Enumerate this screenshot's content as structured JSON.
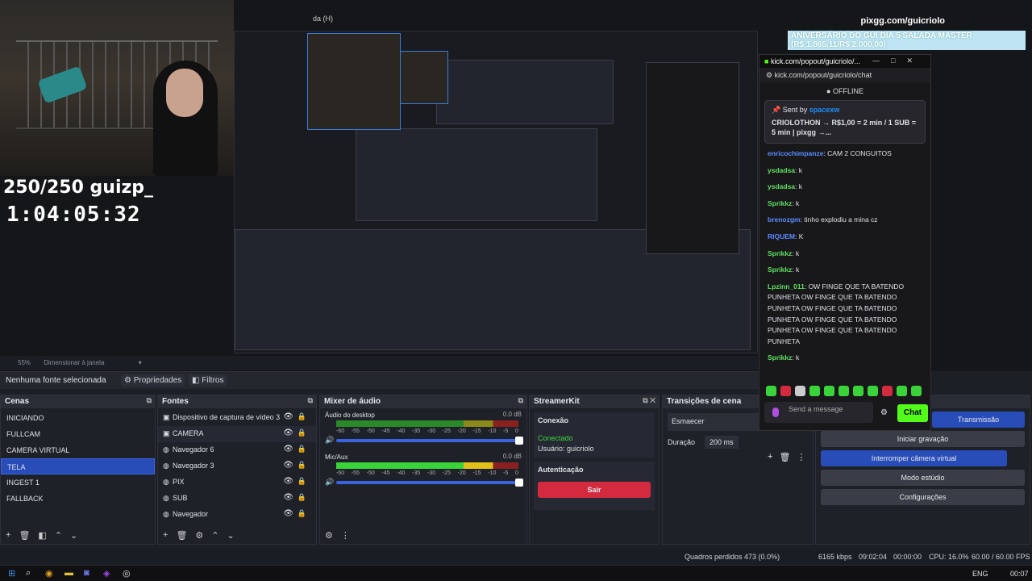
{
  "stream": {
    "channel_url": "pixgg.com/guicriolo",
    "banner_line1": "ANIVERSÁRIO DO GUI DIA 5 SALADA MASTER",
    "banner_line2": "(R$ 1.865,11/R$ 2.000,00)",
    "counter": "250/250 guizp_",
    "timer": "1:04:05:32"
  },
  "menu_fragment": "da (H)",
  "zoom": {
    "value": "55%",
    "label": "Dimensionar à janela"
  },
  "source_bar": {
    "status": "Nenhuma fonte selecionada",
    "properties": "Propriedades",
    "filters": "Filtros"
  },
  "scenes": {
    "title": "Cenas",
    "items": [
      "INICIANDO",
      "FULLCAM",
      "CAMERA VIRTUAL",
      "TELA",
      "INGEST 1",
      "FALLBACK"
    ],
    "selected": 3
  },
  "sources": {
    "title": "Fontes",
    "items": [
      "Dispositivo de captura de vídeo 3",
      "CAMERA",
      "Navegador 6",
      "Navegador 3",
      "PIX",
      "SUB",
      "Navegador"
    ]
  },
  "mixer": {
    "title": "Mixer de áudio",
    "channels": [
      {
        "name": "Áudio do desktop",
        "db": "0.0 dB"
      },
      {
        "name": "Mic/Aux",
        "db": "0.0 dB"
      }
    ],
    "ticks": [
      "-60",
      "-55",
      "-50",
      "-45",
      "-40",
      "-35",
      "-30",
      "-25",
      "-20",
      "-15",
      "-10",
      "-5",
      "0"
    ]
  },
  "streamerkit": {
    "title": "StreamerKit",
    "connection_label": "Conexão",
    "status": "Conectado",
    "user": "Usuário: guicriolo",
    "auth_label": "Autenticação",
    "logout": "Sair"
  },
  "transitions": {
    "title": "Transições de cena",
    "selected": "Esmaecer",
    "duration_label": "Duração",
    "duration": "200 ms"
  },
  "controls": {
    "stream": "Transmissão",
    "record": "Iniciar gravação",
    "virtual_cam": "Interromper câmera virtual",
    "studio": "Modo estúdio",
    "settings": "Configurações"
  },
  "chat": {
    "window_title": "kick.com/popout/guicriolo/...",
    "url": "kick.com/popout/guicriolo/chat",
    "status": "OFFLINE",
    "pinned_by_label": "Sent by",
    "pinned_by": "spacexw",
    "pinned_msg": "CRIOLOTHON → R$1,00 = 2 min / 1 SUB = 5 min | pixgg →...",
    "messages": [
      {
        "user": "enricochimpanze",
        "text": "CAM 2 CONGUITOS",
        "style": "u1"
      },
      {
        "user": "ysdadsa",
        "text": "k",
        "style": "u2"
      },
      {
        "user": "ysdadsa",
        "text": "k",
        "style": "u2"
      },
      {
        "user": "Sprikkz",
        "text": "k",
        "style": "u2"
      },
      {
        "user": "brenozgm",
        "text": "tinho explodiu a mina cz",
        "style": "u1"
      },
      {
        "user": "RIQUEM",
        "text": "K",
        "style": "u1"
      },
      {
        "user": "Sprikkz",
        "text": "k",
        "style": "u2"
      },
      {
        "user": "Sprikkz",
        "text": "k",
        "style": "u2"
      },
      {
        "user": "Lpzinn_011",
        "text": "OW FINGE QUE TA BATENDO PUNHETA OW FINGE QUE TA BATENDO PUNHETA OW FINGE QUE TA BATENDO PUNHETA OW FINGE QUE TA BATENDO PUNHETA OW FINGE QUE TA BATENDO PUNHETA",
        "style": "u2"
      },
      {
        "user": "Sprikkz",
        "text": "k",
        "style": "u2"
      }
    ],
    "send_placeholder": "Send a message",
    "send_button": "Chat"
  },
  "status": {
    "dropped": "Quadros perdidos 473 (0.0%)",
    "bitrate": "6165 kbps",
    "live_time": "09:02:04",
    "rec_time": "00:00:00",
    "cpu": "CPU: 16.0%",
    "fps": "60.00 / 60.00 FPS"
  },
  "taskbar": {
    "lang": "ENG",
    "time": "00:07"
  }
}
